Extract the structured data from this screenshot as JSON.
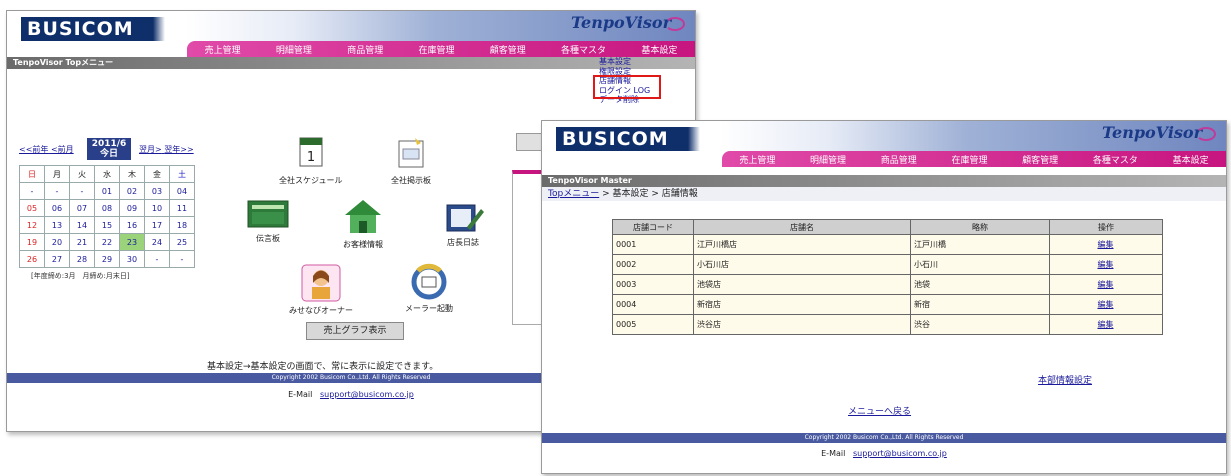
{
  "main_window": {
    "logo": "BUSICOM",
    "brand": "TenpoVisor",
    "nav": [
      "売上管理",
      "明細管理",
      "商品管理",
      "在庫管理",
      "顧客管理",
      "各種マスタ",
      "基本設定"
    ],
    "subbar_title": "TenpoVisor Topメニュー",
    "dropdown": [
      "基本設定",
      "権限設定",
      "店舗情報",
      "ログイン LOG",
      "データ削除"
    ],
    "calendar": {
      "prev_year": "<<前年",
      "prev_month": "<前月",
      "month": "2011/6",
      "today": "今日",
      "next_month": "翌月>",
      "next_year": "翌年>>",
      "weekdays": [
        "日",
        "月",
        "火",
        "水",
        "木",
        "金",
        "土"
      ],
      "weeks": [
        [
          "-",
          "-",
          "-",
          "01",
          "02",
          "03",
          "04"
        ],
        [
          "05",
          "06",
          "07",
          "08",
          "09",
          "10",
          "11"
        ],
        [
          "12",
          "13",
          "14",
          "15",
          "16",
          "17",
          "18"
        ],
        [
          "19",
          "20",
          "21",
          "22",
          "23",
          "24",
          "25"
        ],
        [
          "26",
          "27",
          "28",
          "29",
          "30",
          "-",
          "-"
        ]
      ],
      "note": "[年度締め:3月　月締め:月末日]"
    },
    "icons": {
      "schedule": "全社スケジュール",
      "board": "全社掲示板",
      "message": "伝言板",
      "customer": "お客様情報",
      "diary": "店長日誌",
      "owner": "みせなびオーナー",
      "mailer": "メーラー起動"
    },
    "chart_button": "売上グラフ表示",
    "info": "基本設定→基本設定の画面で、常に表示に設定できます。",
    "copyright": "Copyright 2002 Busicom Co.,Ltd. All Rights Reserved",
    "email_label": "E-Mail",
    "email": "support@busicom.co.jp"
  },
  "master_window": {
    "logo": "BUSICOM",
    "brand": "TenpoVisor",
    "nav": [
      "売上管理",
      "明細管理",
      "商品管理",
      "在庫管理",
      "顧客管理",
      "各種マスタ",
      "基本設定"
    ],
    "subbar_title": "TenpoVisor Master",
    "breadcrumb_link": "Topメニュー",
    "breadcrumb_rest": " > 基本設定 > 店舗情報",
    "table": {
      "headers": [
        "店舗コード",
        "店舗名",
        "略称",
        "操作"
      ],
      "rows": [
        [
          "0001",
          "江戸川橋店",
          "江戸川橋",
          "編集"
        ],
        [
          "0002",
          "小石川店",
          "小石川",
          "編集"
        ],
        [
          "0003",
          "池袋店",
          "池袋",
          "編集"
        ],
        [
          "0004",
          "新宿店",
          "新宿",
          "編集"
        ],
        [
          "0005",
          "渋谷店",
          "渋谷",
          "編集"
        ]
      ]
    },
    "headquarters_link": "本部情報設定",
    "back_link": "メニューへ戻る",
    "copyright": "Copyright 2002 Busicom Co.,Ltd. All Rights Reserved",
    "email_label": "E-Mail",
    "email": "support@busicom.co.jp"
  }
}
